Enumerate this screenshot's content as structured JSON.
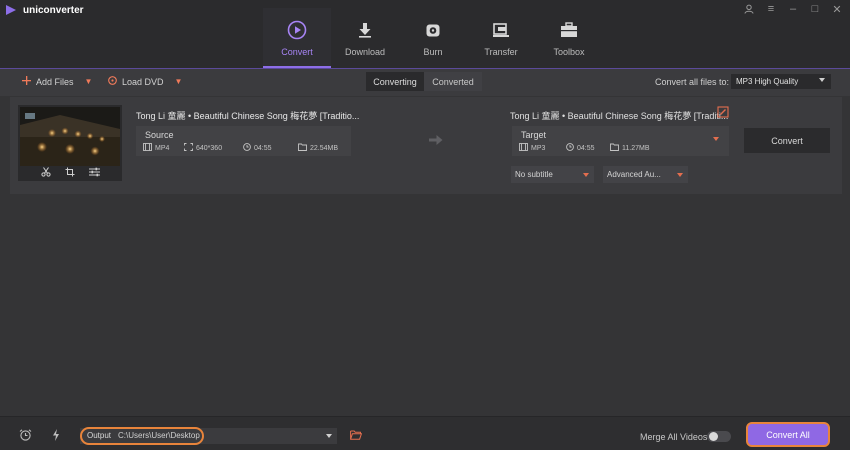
{
  "app": {
    "name": "uniconverter",
    "accent": "#8d6ee8",
    "highlight": "#e8843b"
  },
  "window_controls": [
    {
      "icon": "account-icon"
    },
    {
      "icon": "menu-icon",
      "label": "≡"
    },
    {
      "icon": "minimize-icon",
      "label": "–"
    },
    {
      "icon": "maximize-icon",
      "label": "□"
    },
    {
      "icon": "close-icon",
      "label": "✕"
    }
  ],
  "nav": {
    "tabs": [
      {
        "label": "Convert",
        "icon": "convert-icon",
        "active": true
      },
      {
        "label": "Download",
        "icon": "download-icon",
        "active": false
      },
      {
        "label": "Burn",
        "icon": "burn-disc-icon",
        "active": false
      },
      {
        "label": "Transfer",
        "icon": "transfer-icon",
        "active": false
      },
      {
        "label": "Toolbox",
        "icon": "toolbox-icon",
        "active": false
      }
    ]
  },
  "toolbar": {
    "add_files": "Add Files",
    "load_dvd": "Load DVD",
    "segments": [
      {
        "label": "Converting",
        "active": true
      },
      {
        "label": "Converted",
        "active": false
      }
    ],
    "convert_all_to_label": "Convert all files to:",
    "format_selected": "MP3 High Quality"
  },
  "file": {
    "title": "Tong Li 童麗 • Beautiful Chinese Song 梅花夢 [Traditio...",
    "source": {
      "label": "Source",
      "format": "MP4",
      "resolution": "640*360",
      "duration": "04:55",
      "size": "22.54MB"
    },
    "target_title": "Tong Li 童麗 • Beautiful Chinese Song 梅花夢 [Traditi...",
    "target": {
      "label": "Target",
      "format": "MP3",
      "duration": "04:55",
      "size": "11.27MB"
    },
    "convert_label": "Convert",
    "subtitle_select": "No subtitle",
    "audio_select": "Advanced Au..."
  },
  "bottom": {
    "output_label": "Output",
    "output_path": "C:\\Users\\User\\Desktop",
    "merge_label": "Merge All Videos",
    "merge_enabled": false,
    "convert_all_label": "Convert All"
  }
}
